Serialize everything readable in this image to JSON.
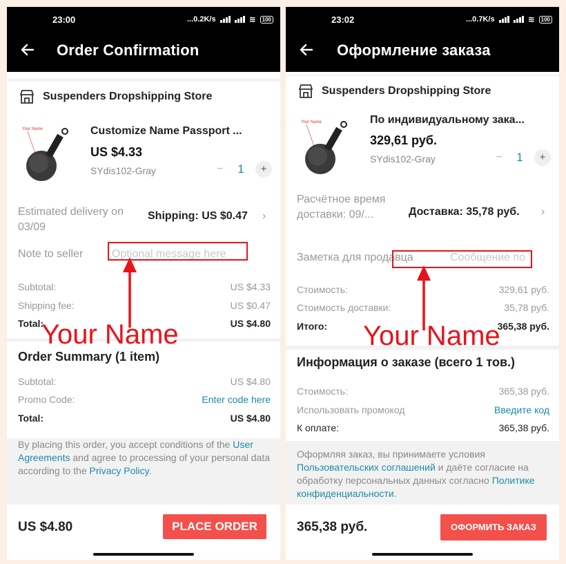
{
  "left": {
    "status": {
      "time": "23:00",
      "speed": "...0.2K/s",
      "battery": "100"
    },
    "header": {
      "title": "Order Confirmation"
    },
    "store": {
      "name": "Suspenders Dropshipping Store"
    },
    "product": {
      "image_caption": "Your Name",
      "title": "Customize Name Passport ...",
      "price": "US $4.33",
      "sku": "SYdis102-Gray",
      "minus": "−",
      "qty": "1",
      "plus": "+"
    },
    "delivery": {
      "label": "Estimated delivery on 03/09",
      "shipping": "Shipping: US $0.47"
    },
    "note": {
      "label": "Note to seller",
      "placeholder": "Optional message here"
    },
    "costs": {
      "subtotal_label": "Subtotal:",
      "subtotal_value": "US $4.33",
      "shipping_label": "Shipping fee:",
      "shipping_value": "US $0.47",
      "total_label": "Total:",
      "total_value": "US $4.80"
    },
    "annotation": "Your Name",
    "summary": {
      "title": "Order Summary (1 item)",
      "subtotal_label": "Subtotal:",
      "subtotal_value": "US $4.80",
      "promo_label": "Promo Code:",
      "promo_link": "Enter code here",
      "total_label": "Total:",
      "total_value": "US $4.80"
    },
    "legal": {
      "p1": "By placing this order, you accept conditions of the ",
      "link1": "User Agreements",
      "p2": " and agree to processing of your personal data according to the ",
      "link2": "Privacy Policy",
      "p3": "."
    },
    "bottom": {
      "total": "US $4.80",
      "button": "PLACE ORDER"
    }
  },
  "right": {
    "status": {
      "time": "23:02",
      "speed": "...0.7K/s",
      "battery": "100"
    },
    "header": {
      "title": "Оформление заказа"
    },
    "store": {
      "name": "Suspenders Dropshipping Store"
    },
    "product": {
      "image_caption": "Your Name",
      "title": "По индивидуальному зака...",
      "price": "329,61 руб.",
      "sku": "SYdis102-Gray",
      "minus": "−",
      "qty": "1",
      "plus": "+"
    },
    "delivery": {
      "label": "Расчётное время доставки: 09/...",
      "shipping": "Доставка: 35,78 руб."
    },
    "note": {
      "label": "Заметка для продавца",
      "placeholder": "Сообщение по"
    },
    "costs": {
      "subtotal_label": "Стоимость:",
      "subtotal_value": "329,61 руб.",
      "shipping_label": "Стоимость доставки:",
      "shipping_value": "35,78 руб.",
      "total_label": "Итого:",
      "total_value": "365,38 руб."
    },
    "annotation": "Your Name",
    "summary": {
      "title": "Информация о заказе (всего 1 тов.)",
      "subtotal_label": "Стоимость:",
      "subtotal_value": "365,38 руб.",
      "promo_label": "Использовать промокод",
      "promo_link": "Введите код",
      "total_label": "К оплате:",
      "total_value": "365,38 руб."
    },
    "legal": {
      "p1": "Оформляя заказ, вы принимаете условия ",
      "link1": "Пользовательских соглашений",
      "p2": " и даёте согласие на обработку персональных данных согласно ",
      "link2": "Политике конфиденциальности",
      "p3": "."
    },
    "bottom": {
      "total": "365,38 руб.",
      "button": "ОФОРМИТЬ ЗАКАЗ"
    }
  },
  "colors": {
    "accent": "#f4504b",
    "link": "#1c8aa8",
    "annotation": "#e8131a",
    "background": "#fbf0e3"
  }
}
